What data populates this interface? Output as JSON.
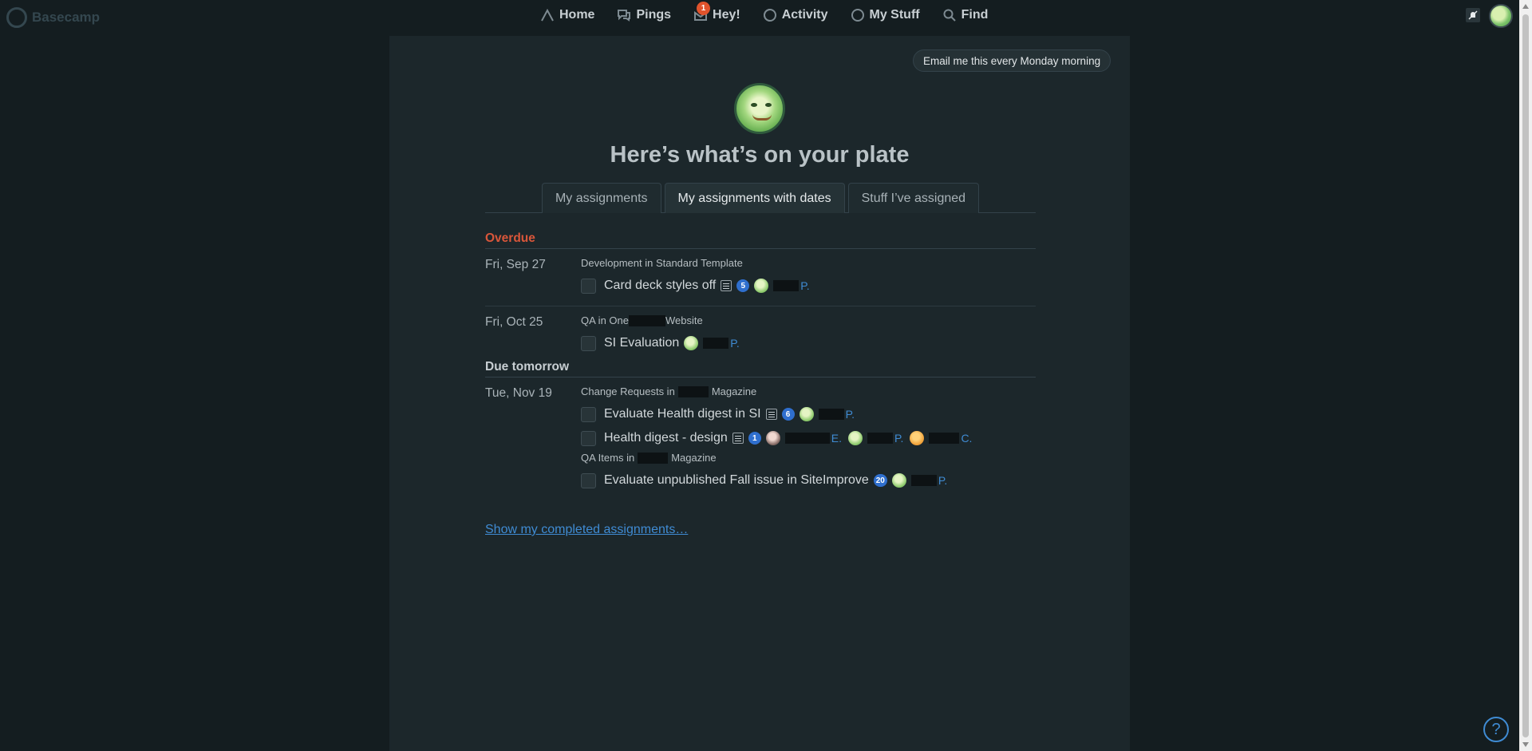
{
  "brand": {
    "name": "Basecamp"
  },
  "nav": {
    "home": "Home",
    "pings": "Pings",
    "hey": "Hey!",
    "hey_badge": "1",
    "activity": "Activity",
    "my_stuff": "My Stuff",
    "find": "Find"
  },
  "main": {
    "email_button": "Email me this every Monday morning",
    "title": "Here’s what’s on your plate",
    "tabs": [
      {
        "label": "My assignments",
        "active": false
      },
      {
        "label": "My assignments with dates",
        "active": true
      },
      {
        "label": "Stuff I’ve assigned",
        "active": false
      }
    ],
    "sections": [
      {
        "heading": "Overdue",
        "groups": [
          {
            "date": "Fri, Sep 27",
            "lists": [
              {
                "title_before": "Development in Standard Template",
                "title_after": "",
                "todos": [
                  {
                    "title": "Card deck styles off",
                    "has_notes": true,
                    "comments": "5",
                    "assignees": [
                      {
                        "initial": "P."
                      }
                    ]
                  }
                ]
              }
            ]
          },
          {
            "date": "Fri, Oct 25",
            "lists": [
              {
                "title_before": "QA in One",
                "title_after": "Website",
                "todos": [
                  {
                    "title": "SI Evaluation",
                    "has_notes": false,
                    "comments": "",
                    "assignees": [
                      {
                        "initial": "P."
                      }
                    ]
                  }
                ]
              }
            ]
          }
        ]
      },
      {
        "heading": "Due tomorrow",
        "groups": [
          {
            "date": "Tue, Nov 19",
            "lists": [
              {
                "title_before": "Change Requests in",
                "title_after": "Magazine",
                "todos": [
                  {
                    "title": "Evaluate Health digest in SI",
                    "has_notes": true,
                    "comments": "6",
                    "assignees": [
                      {
                        "initial": "P."
                      }
                    ]
                  },
                  {
                    "title": "Health digest - design",
                    "has_notes": true,
                    "comments": "1",
                    "assignees": [
                      {
                        "initial": "E."
                      },
                      {
                        "initial": "P."
                      },
                      {
                        "initial": "C."
                      }
                    ]
                  }
                ]
              },
              {
                "title_before": "QA Items in",
                "title_after": "Magazine",
                "todos": [
                  {
                    "title": "Evaluate unpublished Fall issue in SiteImprove",
                    "has_notes": false,
                    "comments": "20",
                    "assignees": [
                      {
                        "initial": "P."
                      }
                    ]
                  }
                ]
              }
            ]
          }
        ]
      }
    ],
    "show_completed": "Show my completed assignments…"
  },
  "help": {
    "label": "?"
  }
}
